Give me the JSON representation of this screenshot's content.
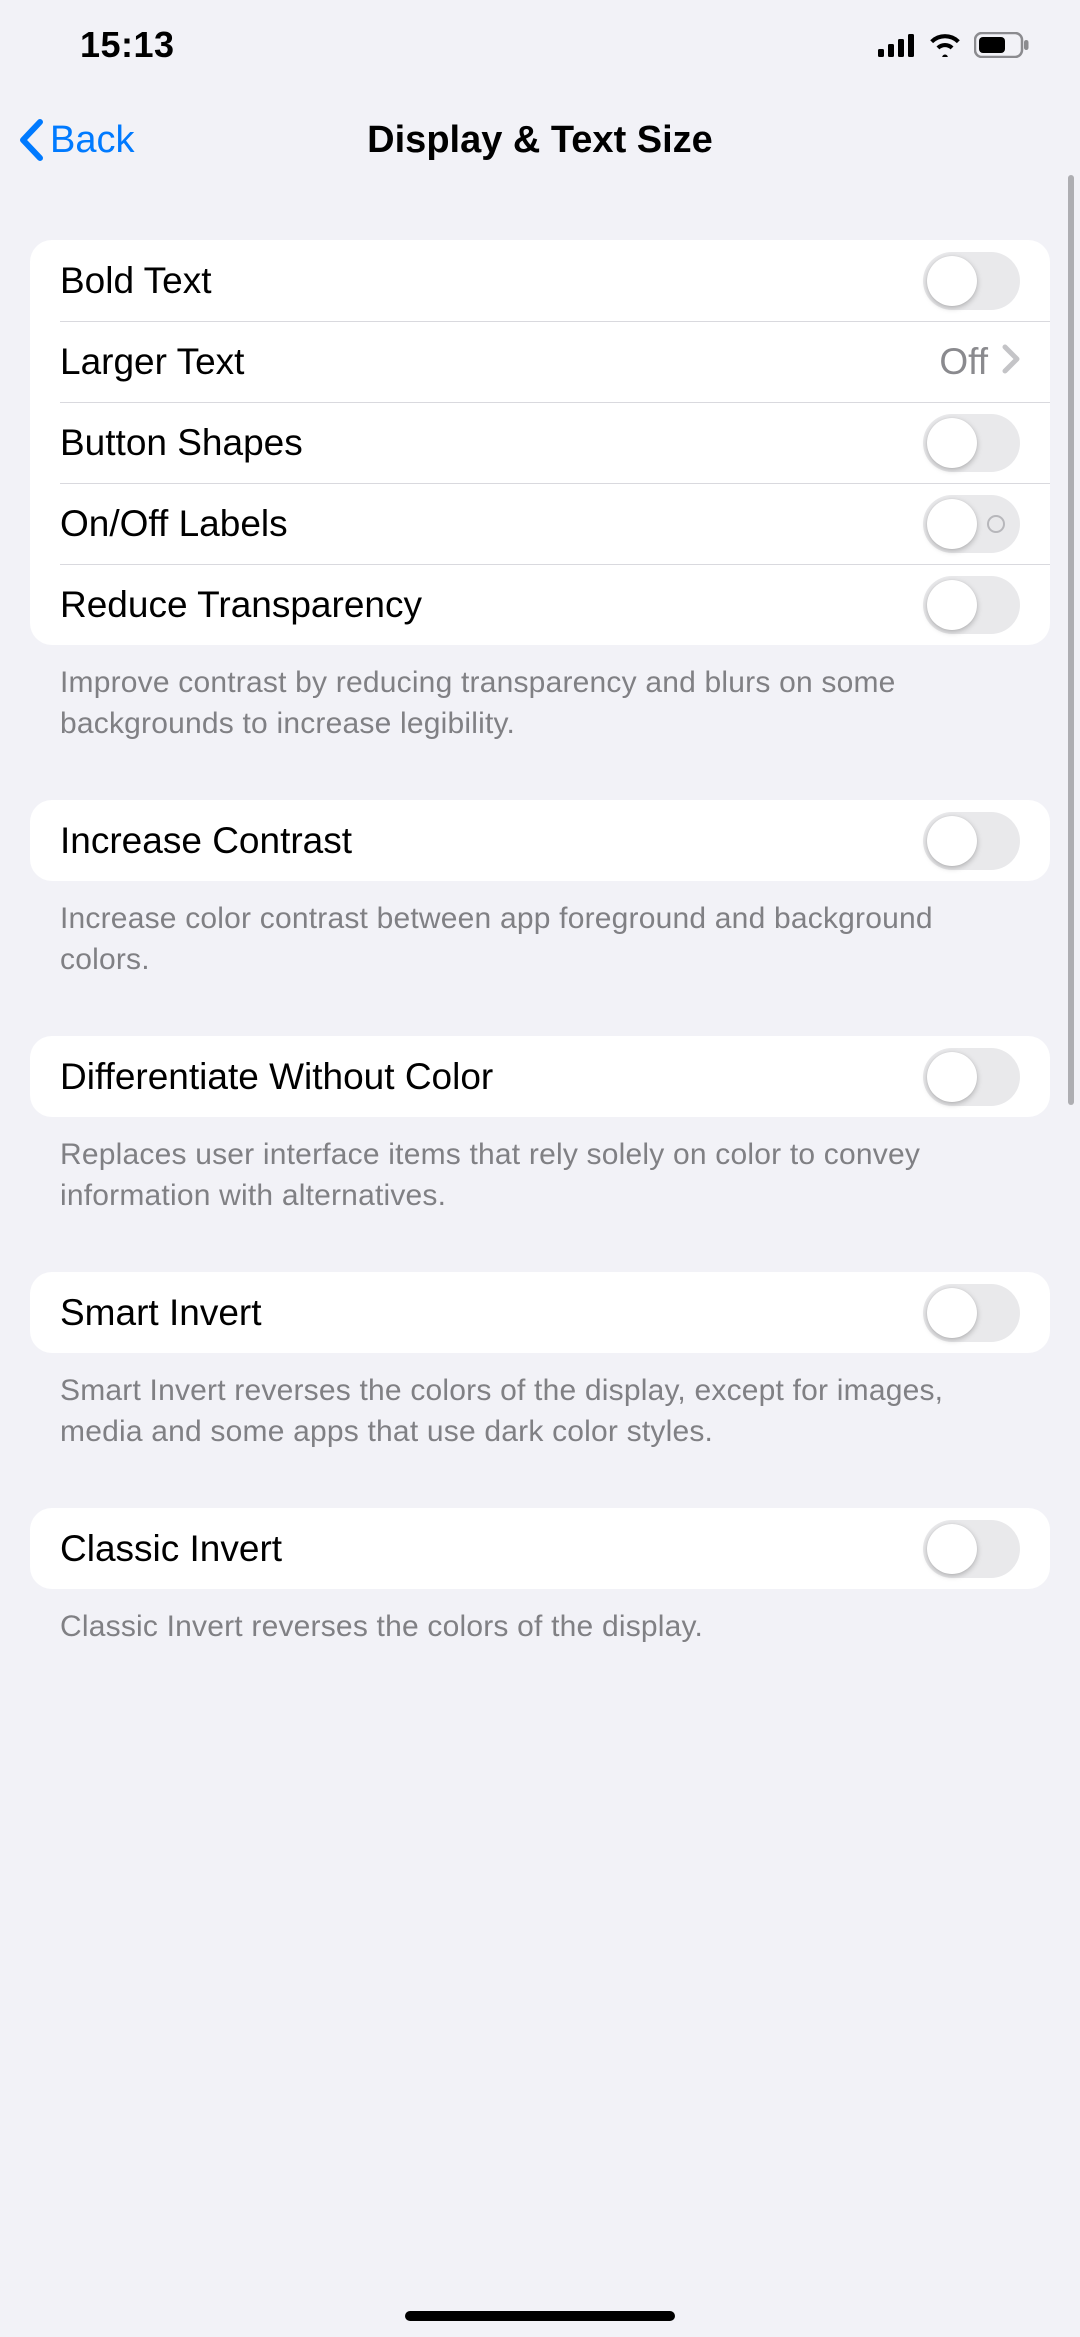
{
  "status": {
    "time": "15:13"
  },
  "nav": {
    "back": "Back",
    "title": "Display & Text Size"
  },
  "groups": [
    {
      "rows": [
        {
          "label": "Bold Text"
        },
        {
          "label": "Larger Text",
          "value": "Off"
        },
        {
          "label": "Button Shapes"
        },
        {
          "label": "On/Off Labels"
        },
        {
          "label": "Reduce Transparency"
        }
      ],
      "footer": "Improve contrast by reducing transparency and blurs on some backgrounds to increase legibility."
    },
    {
      "rows": [
        {
          "label": "Increase Contrast"
        }
      ],
      "footer": "Increase color contrast between app foreground and background colors."
    },
    {
      "rows": [
        {
          "label": "Differentiate Without Color"
        }
      ],
      "footer": "Replaces user interface items that rely solely on color to convey information with alternatives."
    },
    {
      "rows": [
        {
          "label": "Smart Invert"
        }
      ],
      "footer": "Smart Invert reverses the colors of the display, except for images, media and some apps that use dark color styles."
    },
    {
      "rows": [
        {
          "label": "Classic Invert"
        }
      ],
      "footer": "Classic Invert reverses the colors of the display."
    }
  ]
}
